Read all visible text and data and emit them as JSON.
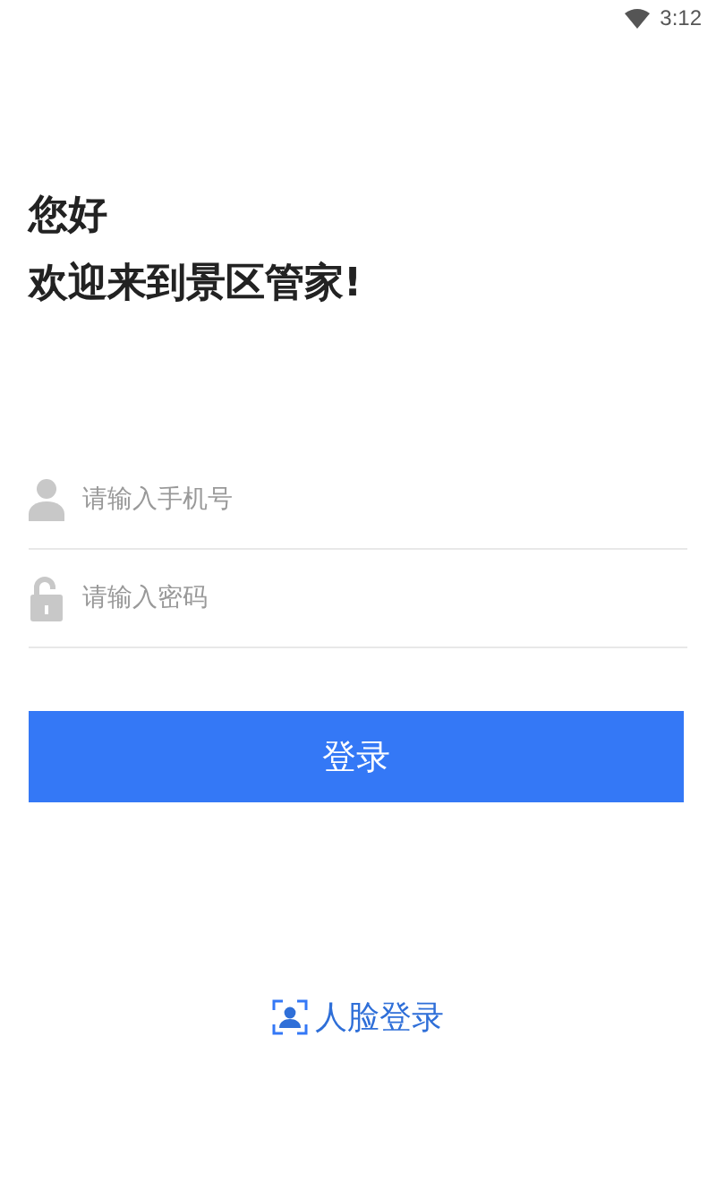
{
  "status_bar": {
    "time": "3:12"
  },
  "greeting": [
    "您好",
    "欢迎来到景区管家!"
  ],
  "fields": [
    {
      "kind": "user",
      "placeholder": "请输入手机号"
    },
    {
      "kind": "lock",
      "placeholder": "请输入密码"
    }
  ],
  "login_button": "登录",
  "face_login": "人脸登录"
}
